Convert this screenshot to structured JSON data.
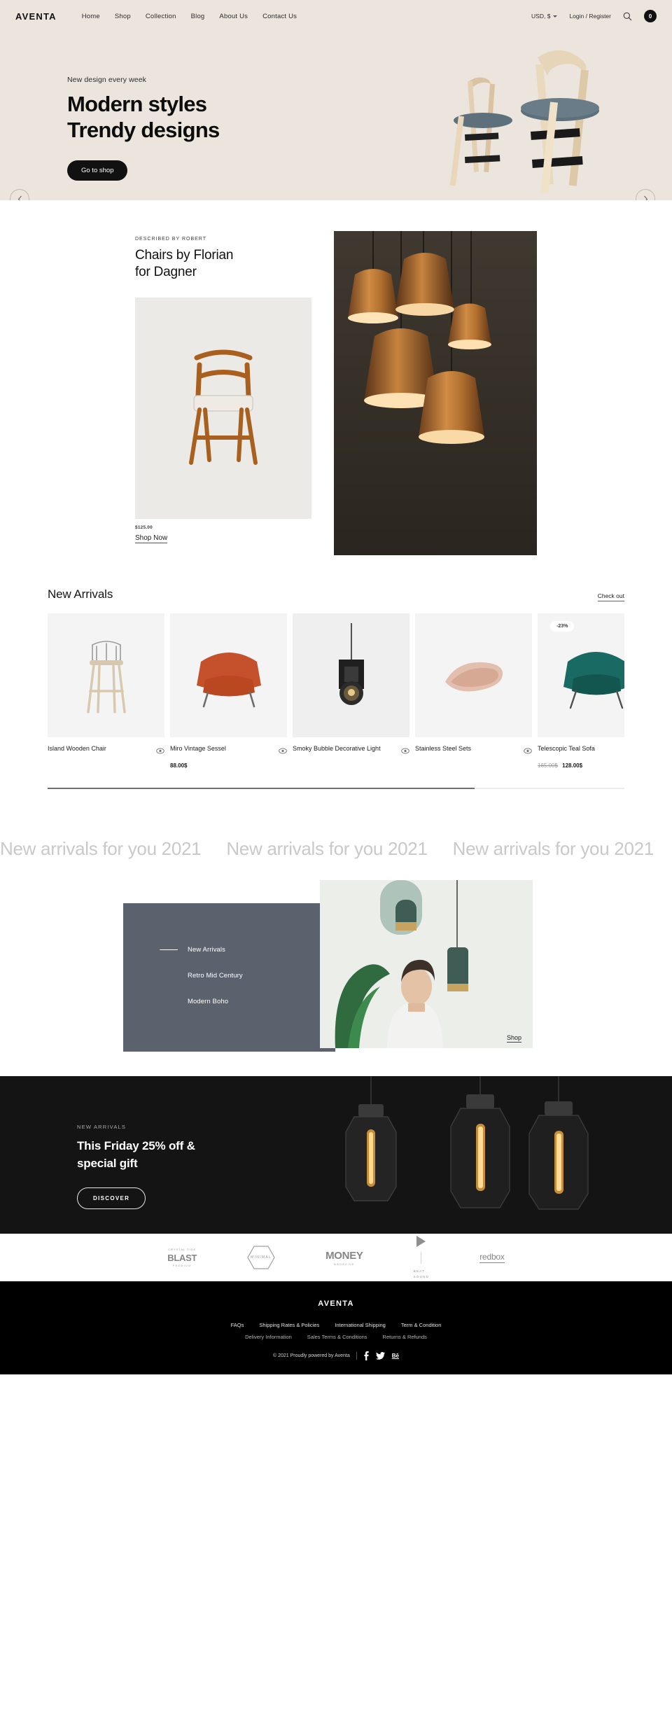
{
  "header": {
    "logo": "AVENTA",
    "nav": [
      {
        "label": "Home"
      },
      {
        "label": "Shop"
      },
      {
        "label": "Collection"
      },
      {
        "label": "Blog"
      },
      {
        "label": "About Us"
      },
      {
        "label": "Contact Us"
      }
    ],
    "currency": "USD, $",
    "account": "Login / Register",
    "search_icon": "search-icon",
    "cart_count": "0"
  },
  "hero": {
    "kicker": "New design every week",
    "title_line1": "Modern styles",
    "title_line2": "Trendy designs",
    "cta": "Go to shop",
    "prev_label": "‹",
    "next_label": "›"
  },
  "feature": {
    "eyebrow": "DESCRIBED BY ROBERT",
    "title_line1": "Chairs by Florian",
    "title_line2": "for Dagner",
    "price": "$125.00",
    "link": "Shop Now"
  },
  "arrivals": {
    "title": "New Arrivals",
    "checkout": "Check out",
    "products": [
      {
        "name": "Island Wooden Chair",
        "price": "",
        "old_price": "",
        "badge": ""
      },
      {
        "name": "Miro Vintage Sessel",
        "price": "88.00$",
        "old_price": "",
        "badge": ""
      },
      {
        "name": "Smoky Bubble Decorative Light",
        "price": "",
        "old_price": "",
        "badge": ""
      },
      {
        "name": "Stainless Steel Sets",
        "price": "",
        "old_price": "",
        "badge": ""
      },
      {
        "name": "Telescopic Teal Sofa",
        "price": "128.00$",
        "old_price": "165.00$",
        "badge": "-23%"
      }
    ]
  },
  "marquee": {
    "text": "New arrivals for you 2021"
  },
  "categories": {
    "items": [
      {
        "label": "New Arrivals",
        "active": true
      },
      {
        "label": "Retro Mid Century",
        "active": false
      },
      {
        "label": "Modern Boho",
        "active": false
      }
    ],
    "shop_link": "Shop"
  },
  "promo": {
    "kicker": "NEW ARRIVALS",
    "title_line1": "This Friday 25% off &",
    "title_line2": "special gift",
    "cta": "DISCOVER"
  },
  "brands": [
    {
      "top": "CRYSTAL TIDE",
      "main": "BLAST",
      "sub": "PREMIUM"
    },
    {
      "main": "MINIMAL"
    },
    {
      "main": "MONEY",
      "sub": "MAGAZINE"
    },
    {
      "main": "BEAT",
      "sub": "SOUND"
    },
    {
      "main": "redbox"
    }
  ],
  "footer": {
    "logo": "AVENTA",
    "links_primary": [
      {
        "label": "FAQs"
      },
      {
        "label": "Shipping Rates & Policies"
      },
      {
        "label": "International Shipping"
      },
      {
        "label": "Term & Condition"
      }
    ],
    "links_secondary": [
      {
        "label": "Delivery Information"
      },
      {
        "label": "Sales Terms & Conditions"
      },
      {
        "label": "Returns & Refunds"
      }
    ],
    "copyright": "© 2021 Proudly powered by Aventa",
    "social": [
      {
        "name": "facebook-icon"
      },
      {
        "name": "twitter-icon"
      },
      {
        "name": "behance-icon",
        "label": "Bē"
      }
    ]
  },
  "colors": {
    "hero_bg": "#ece5de",
    "accent_dark": "#111111",
    "panel_slate": "#5c626d",
    "promo_bg": "#141414"
  }
}
